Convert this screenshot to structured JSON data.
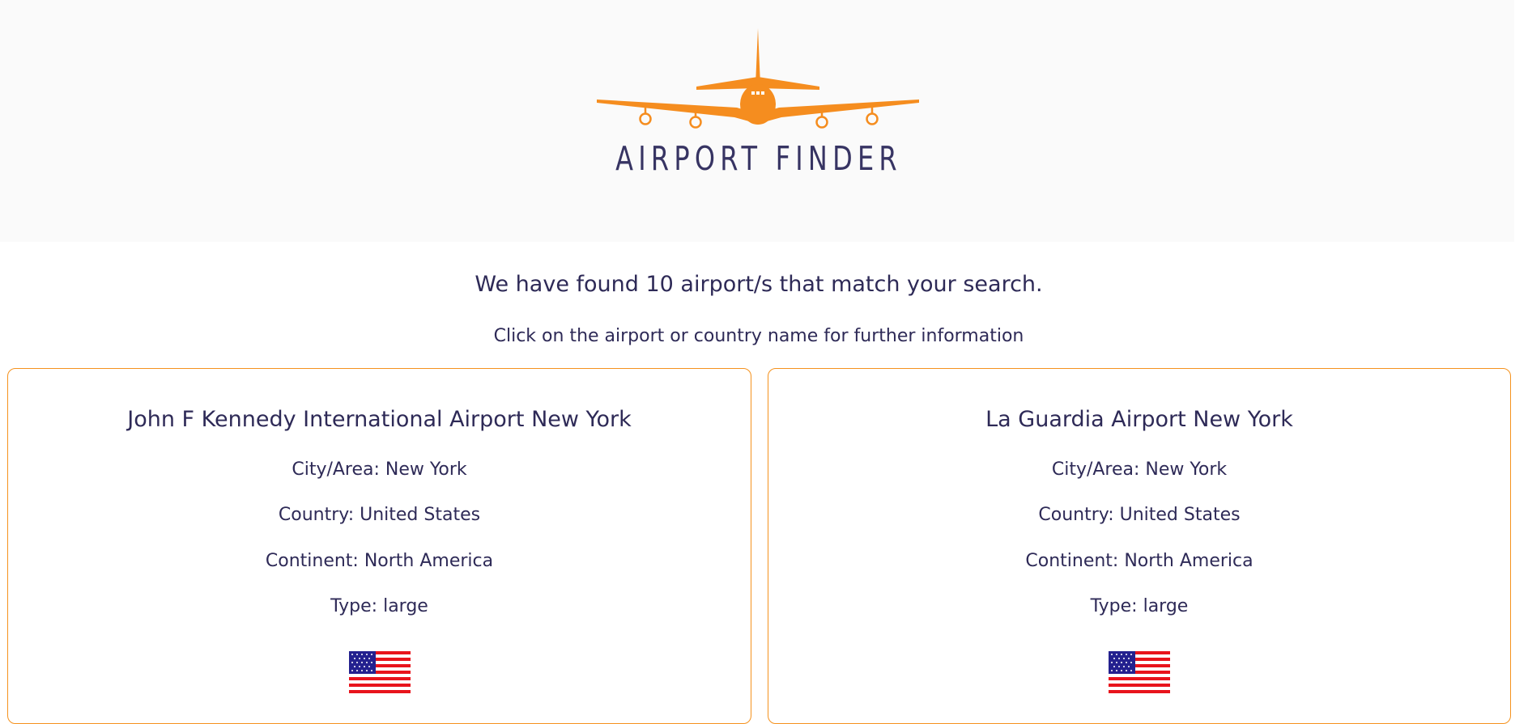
{
  "brand": {
    "logo_text": "AIRPORT FINDER",
    "accent_color": "#f5921e",
    "text_color": "#2e2a57"
  },
  "results": {
    "heading": "We have found 10 airport/s that match your search.",
    "subheading": "Click on the airport or country name for further information"
  },
  "airports": [
    {
      "name": "John F Kennedy International Airport New York",
      "city_label": "City/Area: New York",
      "country_label": "Country: United States",
      "continent_label": "Continent: North America",
      "type_label": "Type: large",
      "flag_icon": "us-flag-icon"
    },
    {
      "name": "La Guardia Airport New York",
      "city_label": "City/Area: New York",
      "country_label": "Country: United States",
      "continent_label": "Continent: North America",
      "type_label": "Type: large",
      "flag_icon": "us-flag-icon"
    }
  ]
}
